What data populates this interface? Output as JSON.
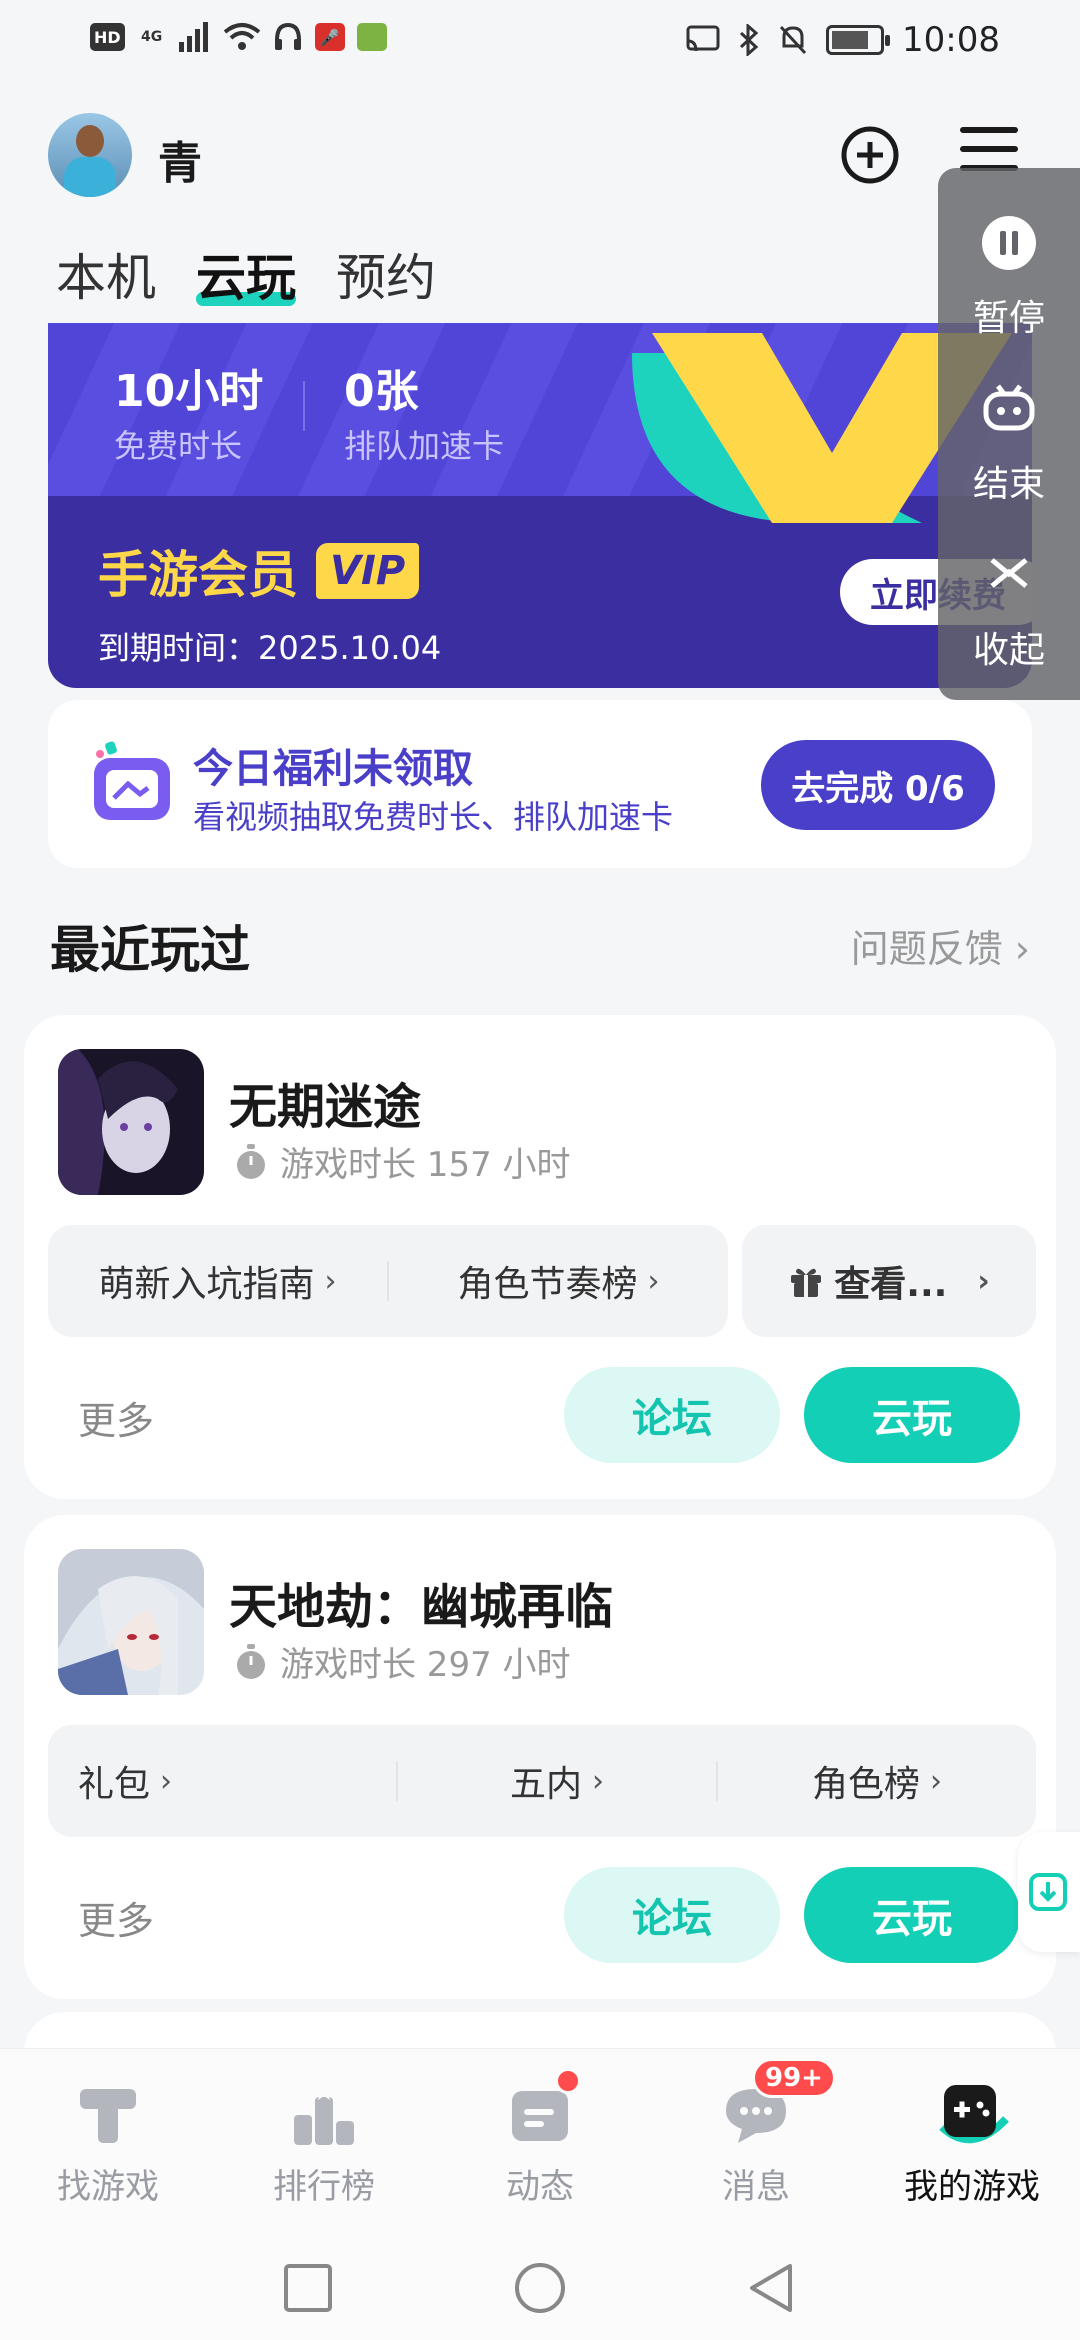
{
  "status_bar": {
    "left_chips": [
      "HD",
      "4G"
    ],
    "time": "10:08"
  },
  "header": {
    "username": "青"
  },
  "tabs": [
    {
      "label": "本机",
      "active": false
    },
    {
      "label": "云玩",
      "active": true
    },
    {
      "label": "预约",
      "active": false
    }
  ],
  "membership": {
    "free_time_value": "10小时",
    "free_time_label": "免费时长",
    "queue_card_value": "0张",
    "queue_card_label": "排队加速卡",
    "title": "手游会员",
    "badge": "VIP",
    "expire": "到期时间：2025.10.04",
    "renew_label": "立即续费"
  },
  "float_panel": {
    "pause_label": "暂停",
    "end_label": "结束",
    "collapse_label": "收起"
  },
  "welfare": {
    "title": "今日福利未领取",
    "subtitle": "看视频抽取免费时长、排队加速卡",
    "button": "去完成 0/6"
  },
  "recent": {
    "title": "最近玩过",
    "feedback": "问题反馈"
  },
  "games": [
    {
      "name": "无期迷途",
      "playtime": "游戏时长 157 小时",
      "chips": [
        "萌新入坑指南",
        "角色节奏榜"
      ],
      "gift_chip": "查看...",
      "more": "更多",
      "forum": "论坛",
      "play": "云玩"
    },
    {
      "name": "天地劫：幽城再临",
      "playtime": "游戏时长 297 小时",
      "chips": [
        "礼包",
        "五内",
        "角色榜"
      ],
      "more": "更多",
      "forum": "论坛",
      "play": "云玩"
    }
  ],
  "bottom_nav": [
    {
      "label": "找游戏",
      "icon": "find-game-icon",
      "active": false
    },
    {
      "label": "排行榜",
      "icon": "ranking-icon",
      "active": false
    },
    {
      "label": "动态",
      "icon": "feed-icon",
      "active": false
    },
    {
      "label": "消息",
      "icon": "message-icon",
      "active": false
    },
    {
      "label": "我的游戏",
      "icon": "my-games-icon",
      "active": true
    }
  ],
  "badges": {
    "messages": "99+"
  },
  "colors": {
    "accent_teal": "#13cfb6",
    "purple": "#4a3fc8",
    "vip_gold": "#ffd84a"
  }
}
